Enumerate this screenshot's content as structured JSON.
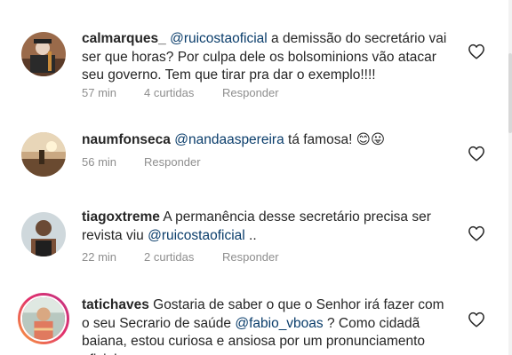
{
  "comments": [
    {
      "username": "calmarques_",
      "mention": "@ruicostaoficial",
      "text_after": " a demissão do secretário vai ser que horas? Por culpa dele os bolsominions vão atacar seu governo. Tem que tirar pra dar o exemplo!!!!",
      "time": "57 min",
      "likes": "4 curtidas",
      "reply": "Responder"
    },
    {
      "username": "naumfonseca",
      "mention": "@nandaaspereira",
      "text_after": " tá famosa! 😊😛",
      "time": "56 min",
      "reply": "Responder"
    },
    {
      "username": "tiagoxtreme",
      "text_before": " A permanência desse secretário precisa ser revista viu ",
      "mention": "@ruicostaoficial",
      "text_after": " ..",
      "time": "22 min",
      "likes": "2 curtidas",
      "reply": "Responder"
    },
    {
      "username": "tatichaves",
      "text_before": " Gostaria de saber o que o Senhor irá fazer com o seu Secrario de saúde ",
      "mention": "@fabio_vboas",
      "text_after": " ? Como cidadã baiana, estou curiosa e ansiosa por um pronunciamento oficial"
    }
  ],
  "icons": {
    "like": "heart-outline-icon"
  },
  "colors": {
    "mention": "#0a3d6b",
    "meta": "#8e8e8e",
    "story_ring": "#e1306c"
  }
}
